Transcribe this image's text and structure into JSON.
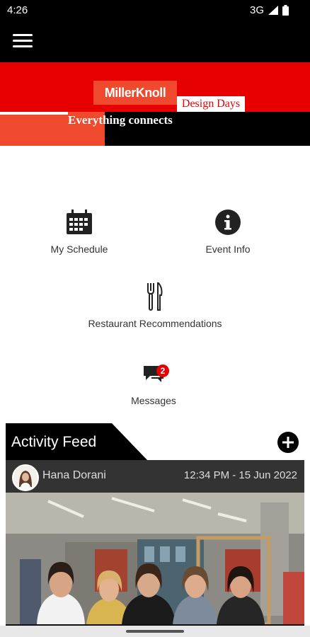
{
  "status_bar": {
    "time": "4:26",
    "network": "3G"
  },
  "app_bar": {
    "menu_icon": "hamburger-menu-icon"
  },
  "banner": {
    "logo": "MillerKnoll",
    "event_name": "Design Days",
    "tagline": "Everything connects",
    "colors": {
      "red": "#e60000",
      "orange_red": "#f04a2e",
      "black": "#000000"
    }
  },
  "tiles": [
    {
      "label": "My Schedule",
      "icon": "calendar-icon"
    },
    {
      "label": "Event Info",
      "icon": "info-icon"
    },
    {
      "label": "Restaurant Recommendations",
      "icon": "utensils-icon"
    },
    {
      "label": "Messages",
      "icon": "chat-bubbles-icon",
      "badge": "2"
    }
  ],
  "feed": {
    "title": "Activity Feed",
    "add_icon": "plus-circle-icon",
    "post": {
      "author": "Hana Dorani",
      "timestamp": "12:34 PM - 15 Jun 2022",
      "photo": "group-photo"
    }
  }
}
